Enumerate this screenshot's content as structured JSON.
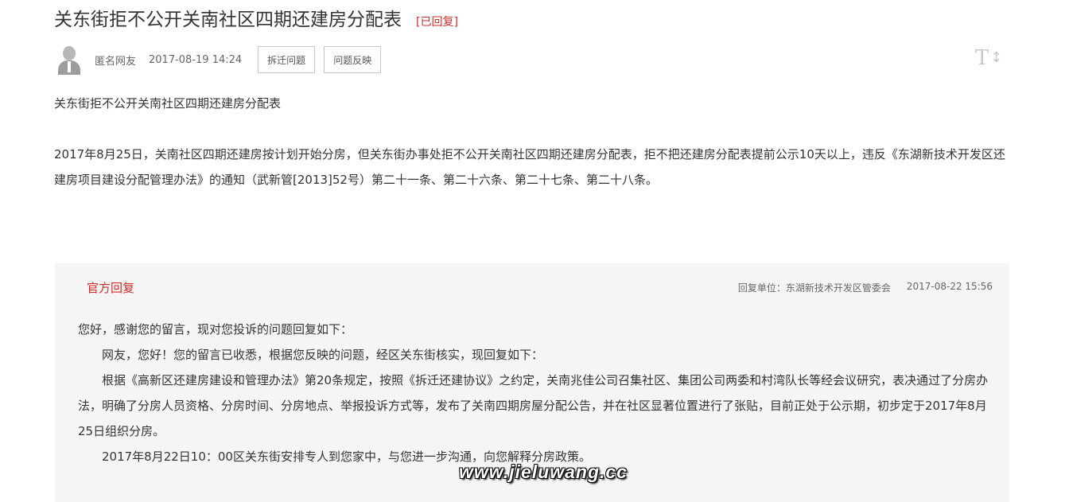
{
  "post": {
    "title": "关东街拒不公开关南社区四期还建房分配表",
    "status": "[已回复]",
    "author": "匿名网友",
    "date": "2017-08-19 14:24",
    "tags": [
      "拆迁问题",
      "问题反映"
    ],
    "font_toggle_icon": "text-size-icon",
    "body_title": "关东街拒不公开关南社区四期还建房分配表",
    "body_paragraph": "2017年8月25日，关南社区四期还建房按计划开始分房，但关东街办事处拒不公开关南社区四期还建房分配表，拒不把还建房分配表提前公示10天以上，违反《东湖新技术开发区还建房项目建设分配管理办法》的通知（武新管[2013]52号）第二十一条、第二十六条、第二十七条、第二十八条。"
  },
  "reply": {
    "label": "官方回复",
    "unit": "回复单位：东湖新技术开发区管委会",
    "date": "2017-08-22 15:56",
    "paragraphs": [
      "您好，感谢您的留言，现对您投诉的问题回复如下：",
      "网友，您好！您的留言已收悉，根据您反映的问题，经区关东街核实，现回复如下：",
      "根据《高新区还建房建设和管理办法》第20条规定，按照《拆迁还建协议》之约定，关南兆佳公司召集社区、集团公司两委和村湾队长等经会议研究，表决通过了分房办法，明确了分房人员资格、分房时间、分房地点、举报投诉方式等，发布了关南四期房屋分配公告，并在社区显著位置进行了张贴，目前正处于公示期，初步定于2017年8月25日组织分房。",
      "2017年8月22日10：00区关东街安排专人到您家中，与您进一步沟通，向您解释分房政策。"
    ]
  },
  "watermark": "www.jieluwang.cc",
  "colors": {
    "accent": "#c9302c",
    "reply_bg": "#f5f5f5"
  }
}
